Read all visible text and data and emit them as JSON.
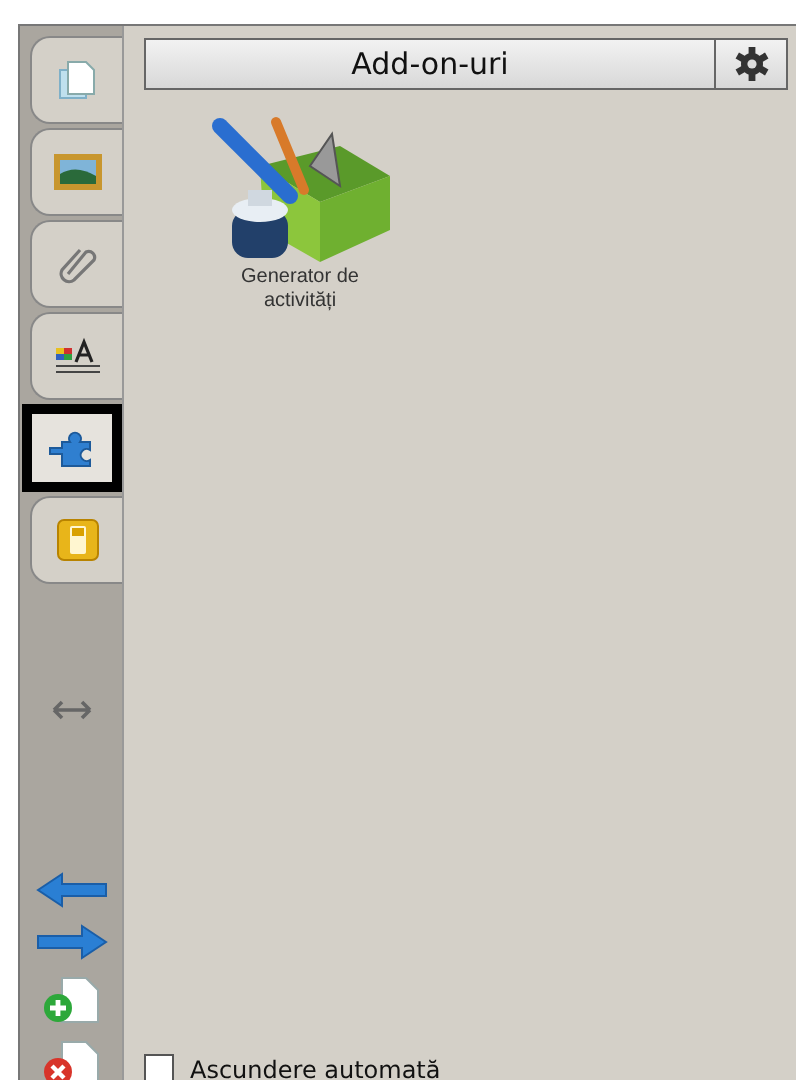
{
  "panel": {
    "title": "Add-on-uri"
  },
  "tabs": [
    {
      "kind": "pages",
      "selected": false
    },
    {
      "kind": "gallery",
      "selected": false
    },
    {
      "kind": "attachments",
      "selected": false
    },
    {
      "kind": "properties",
      "selected": false
    },
    {
      "kind": "addons",
      "selected": true
    },
    {
      "kind": "response",
      "selected": false
    }
  ],
  "addons": [
    {
      "name": "Generator de activități"
    }
  ],
  "auto_hide": {
    "label": "Ascundere automată",
    "checked": false
  }
}
